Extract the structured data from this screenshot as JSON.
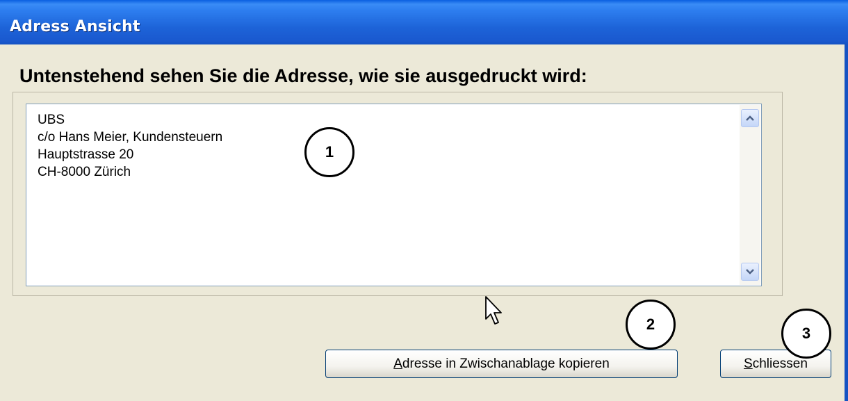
{
  "window": {
    "title": "Adress Ansicht"
  },
  "heading": "Untenstehend sehen Sie die Adresse, wie sie ausgedruckt wird:",
  "address_lines": [
    "UBS",
    "c/o  Hans Meier, Kundensteuern",
    "Hauptstrasse 20",
    "CH-8000 Zürich"
  ],
  "buttons": {
    "copy": {
      "mnemonic": "A",
      "rest": "dresse in Zwischanablage kopieren"
    },
    "close": {
      "mnemonic": "S",
      "rest": "chliessen"
    }
  },
  "callouts": [
    "1",
    "2",
    "3"
  ],
  "icons": {
    "scroll_up": "chevron-up-icon",
    "scroll_down": "chevron-down-icon",
    "cursor": "mouse-pointer-icon"
  },
  "colors": {
    "titlebar": "#1d63d8",
    "dialog_bg": "#ece9d8",
    "button_border": "#003c74"
  }
}
